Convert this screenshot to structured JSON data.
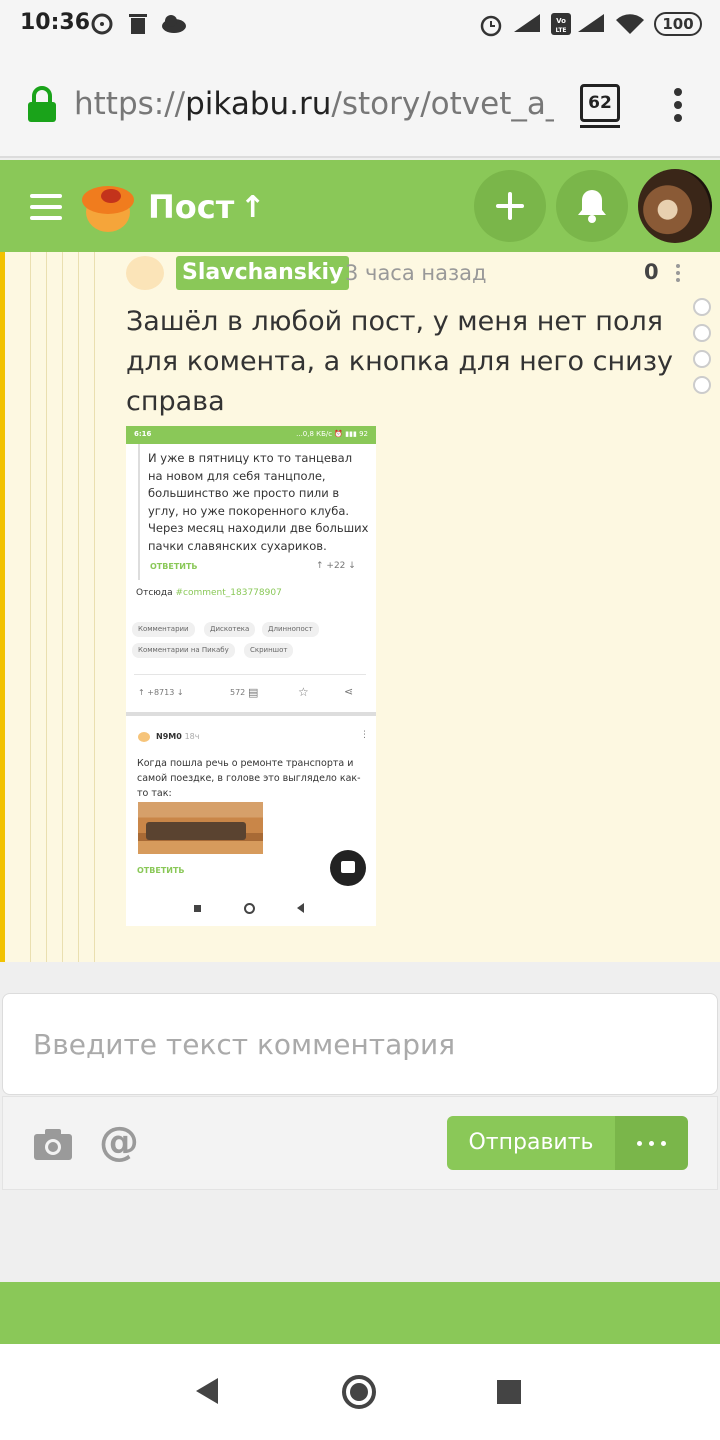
{
  "status_bar": {
    "time": "10:36",
    "battery": "100",
    "volte": "Vo LTE"
  },
  "browser": {
    "url_prefix": "https://",
    "url_host": "pikabu.ru",
    "url_path": "/story/otvet_a_vy",
    "tab_count": "62"
  },
  "header": {
    "title": "Пост",
    "up_arrow": "↑"
  },
  "comment": {
    "username": "Slavchanskiy",
    "time": "3 часа назад",
    "score": "0",
    "text": "Зашёл в любой пост, у меня нет поля для комента, а кнопка для него снизу справа"
  },
  "embedded": {
    "status_time": "6:16",
    "status_right": "...0,8 КБ/с ⏰ ▮▮▮ 92",
    "quote_text": "И уже в пятницу кто то танцевал на новом для себя танцполе, большинство же просто пили в углу, но уже покоренного клуба. Через месяц находили две больших пачки славянских сухариков.",
    "reply_label": "ОТВЕТИТЬ",
    "reply_vote": "↑ +22 ↓",
    "source_label": "Отсюда",
    "source_link": "#comment_183778907",
    "tags": [
      "Комментарии",
      "Дискотека",
      "Длиннопост",
      "Комментарии на Пикабу",
      "Скриншот"
    ],
    "post_rating": "↑ +8713 ↓",
    "post_comments": "572",
    "comment2_user": "N9M0",
    "comment2_time": "18ч",
    "comment2_text": "Когда пошла речь о ремонте транспорта и самой поездке, в голове это выглядело как-то так:",
    "reply2_label": "ОТВЕТИТЬ"
  },
  "comment_form": {
    "placeholder": "Введите текст комментария",
    "send_label": "Отправить"
  },
  "colors": {
    "brand_green": "#8ac858",
    "thread_bg": "#fdf8e1",
    "thread_bar": "#f2c200"
  }
}
